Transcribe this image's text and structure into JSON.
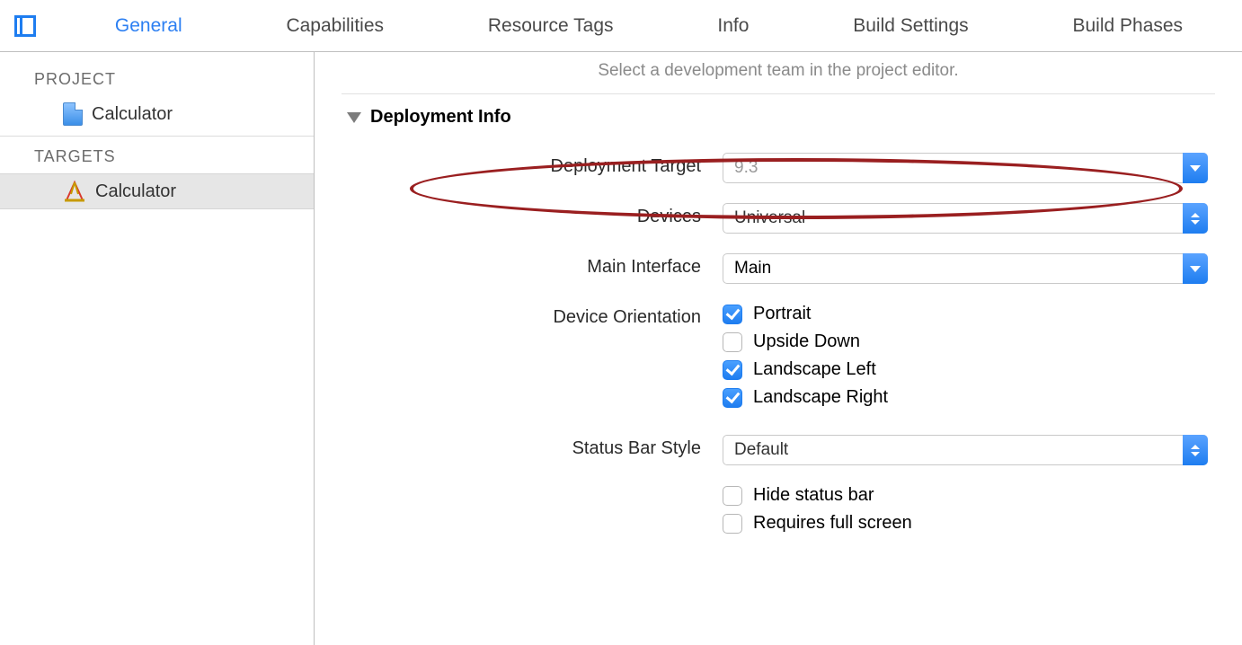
{
  "tabs": {
    "general": "General",
    "capabilities": "Capabilities",
    "resource_tags": "Resource Tags",
    "info": "Info",
    "build_settings": "Build Settings",
    "build_phases": "Build Phases"
  },
  "sidebar": {
    "project_heading": "PROJECT",
    "targets_heading": "TARGETS",
    "project_name": "Calculator",
    "target_name": "Calculator"
  },
  "content": {
    "hint": "Select a development team in the project editor.",
    "section_title": "Deployment Info",
    "labels": {
      "deployment_target": "Deployment Target",
      "devices": "Devices",
      "main_interface": "Main Interface",
      "device_orientation": "Device Orientation",
      "status_bar_style": "Status Bar Style"
    },
    "values": {
      "deployment_target_placeholder": "9.3",
      "devices": "Universal",
      "main_interface": "Main",
      "status_bar_style": "Default"
    },
    "orientation": {
      "portrait": "Portrait",
      "upside_down": "Upside Down",
      "landscape_left": "Landscape Left",
      "landscape_right": "Landscape Right"
    },
    "status_bar_opts": {
      "hide_status_bar": "Hide status bar",
      "requires_full_screen": "Requires full screen"
    }
  }
}
